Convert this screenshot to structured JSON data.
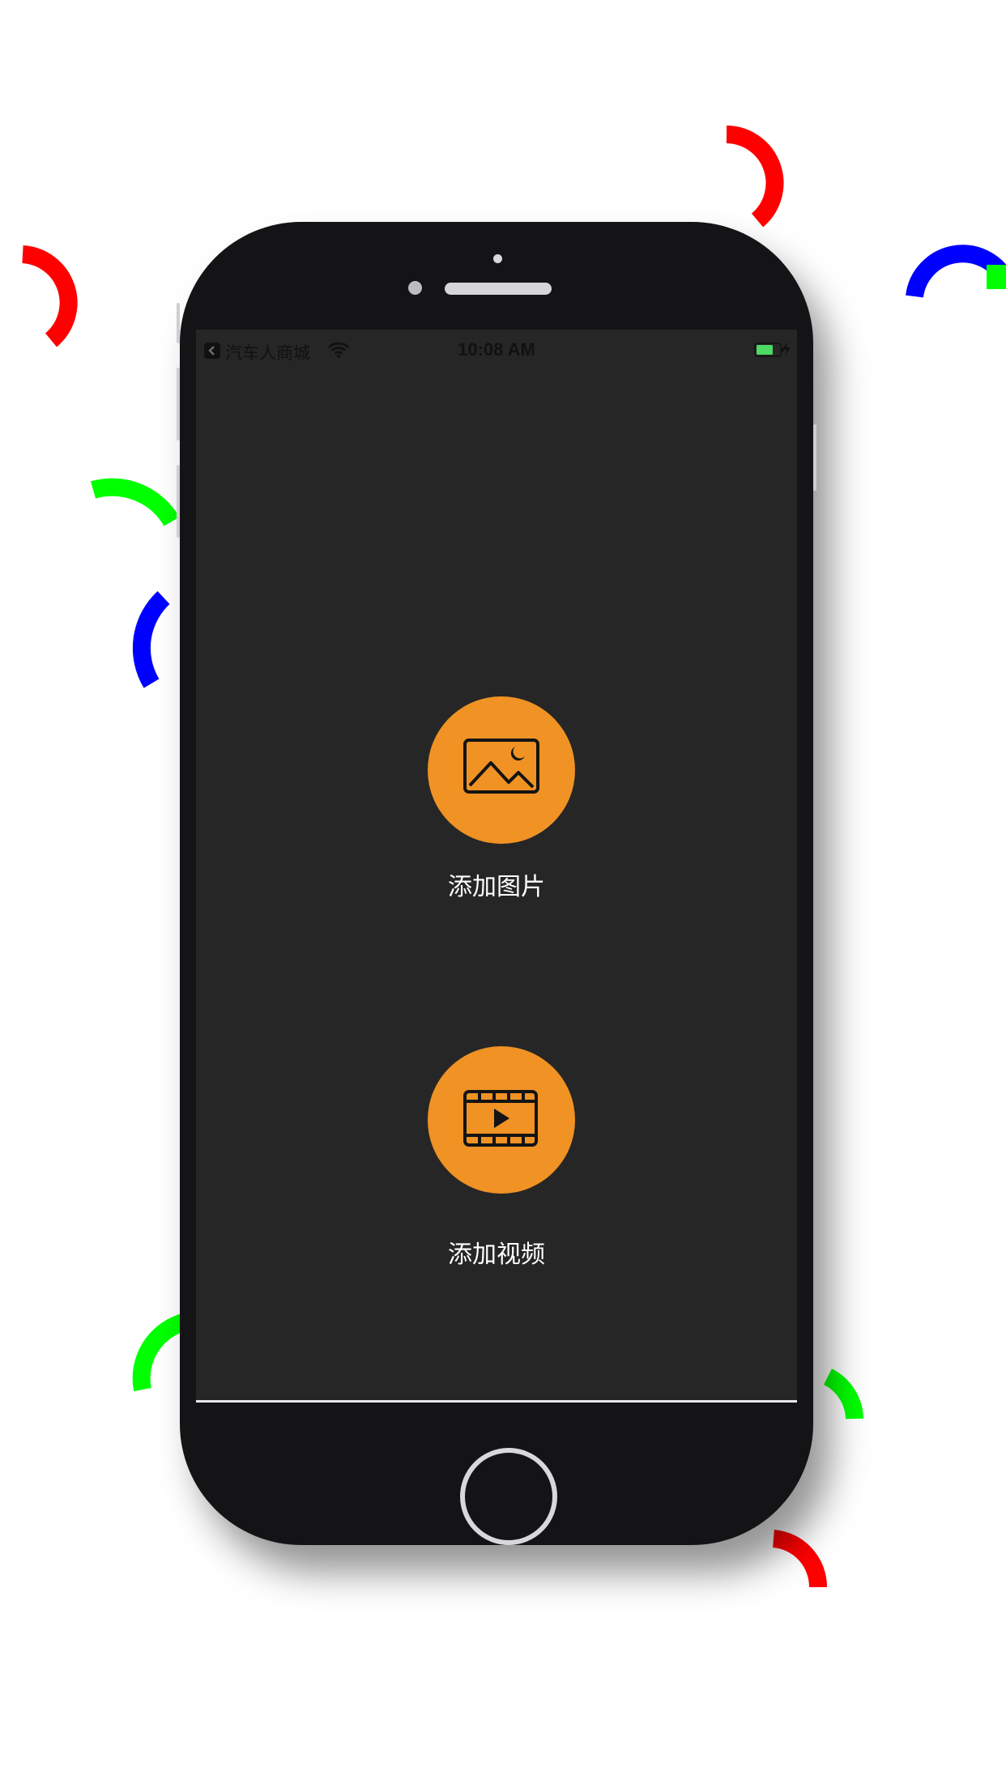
{
  "status_bar": {
    "back_app": "汽车人商城",
    "time": "10:08 AM",
    "battery_color": "#4cd964"
  },
  "actions": [
    {
      "label": "添加图片",
      "icon": "image-icon"
    },
    {
      "label": "添加视频",
      "icon": "video-icon"
    }
  ],
  "theme": {
    "screen_background": "#262626",
    "accent": "#f09224",
    "phone_body": "#141417",
    "decor_colors": [
      "#ff0000",
      "#00ff00",
      "#0000ff"
    ]
  }
}
